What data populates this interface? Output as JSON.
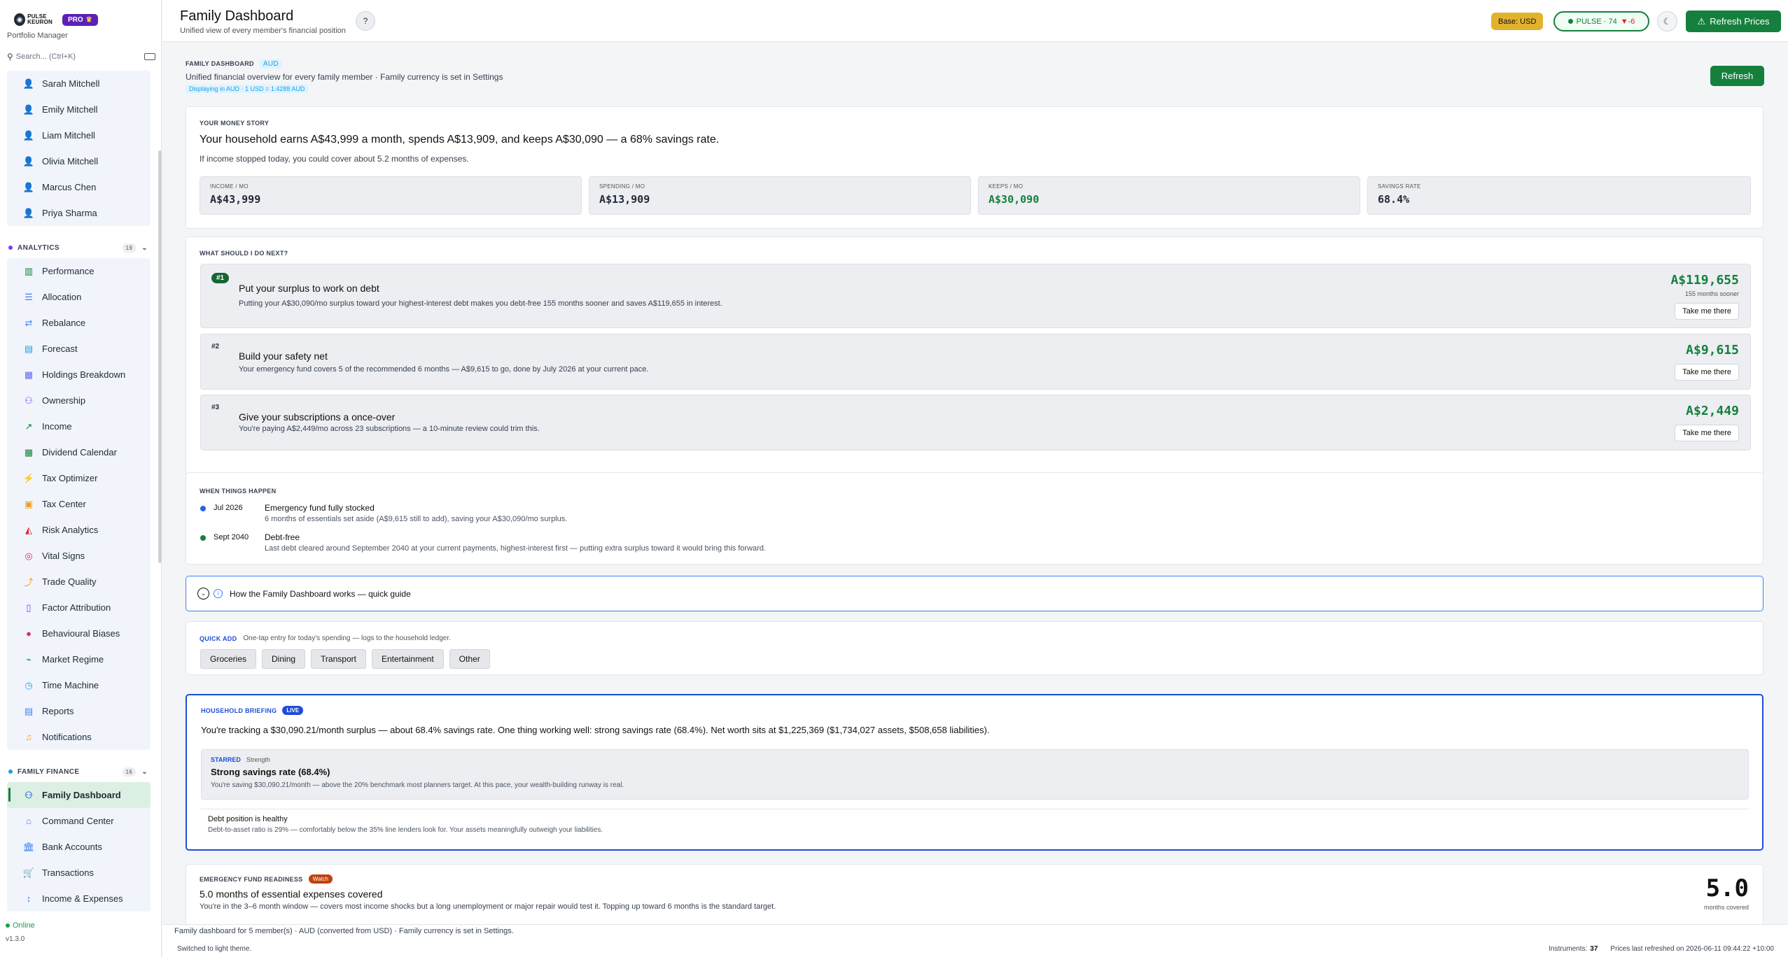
{
  "brand": {
    "logo_line1": "PULSE",
    "logo_line2": "KEURON",
    "pro": "PRO",
    "app_subtitle": "Portfolio Manager"
  },
  "search": {
    "placeholder": "Search... (Ctrl+K)"
  },
  "members": [
    "Sarah Mitchell",
    "Emily Mitchell",
    "Liam Mitchell",
    "Olivia Mitchell",
    "Marcus Chen",
    "Priya Sharma"
  ],
  "analytics": {
    "title": "ANALYTICS",
    "count": "19",
    "items": [
      "Performance",
      "Allocation",
      "Rebalance",
      "Forecast",
      "Holdings Breakdown",
      "Ownership",
      "Income",
      "Dividend Calendar",
      "Tax Optimizer",
      "Tax Center",
      "Risk Analytics",
      "Vital Signs",
      "Trade Quality",
      "Factor Attribution",
      "Behavioural Biases",
      "Market Regime",
      "Time Machine",
      "Reports",
      "Notifications"
    ]
  },
  "family": {
    "title": "FAMILY FINANCE",
    "count": "16",
    "items": [
      "Family Dashboard",
      "Command Center",
      "Bank Accounts",
      "Transactions",
      "Income & Expenses"
    ]
  },
  "status": {
    "online": "Online",
    "version": "v1.3.0"
  },
  "header": {
    "title": "Family Dashboard",
    "subtitle": "Unified view of every member's financial position",
    "help": "?",
    "base": "Base: USD",
    "pulse_label": "PULSE · 74",
    "pulse_change": "▼-6",
    "refresh_prices": "Refresh Prices"
  },
  "intro": {
    "label": "FAMILY DASHBOARD",
    "currency": "AUD",
    "desc": "Unified financial overview for every family member · Family currency is set in Settings",
    "rate_note": "Displaying in AUD · 1 USD = 1.4288 AUD",
    "refresh": "Refresh"
  },
  "story": {
    "label": "YOUR MONEY STORY",
    "headline": "Your household earns A$43,999 a month, spends A$13,909, and keeps A$30,090 — a 68% savings rate.",
    "sub": "If income stopped today, you could cover about 5.2 months of expenses.",
    "stats": [
      {
        "label": "INCOME / MO",
        "value": "A$43,999"
      },
      {
        "label": "SPENDING / MO",
        "value": "A$13,909"
      },
      {
        "label": "KEEPS / MO",
        "value": "A$30,090"
      },
      {
        "label": "SAVINGS RATE",
        "value": "68.4%"
      }
    ]
  },
  "next": {
    "label": "WHAT SHOULD I DO NEXT?",
    "items": [
      {
        "num": "#1",
        "title": "Put your surplus to work on debt",
        "desc": "Putting your A$30,090/mo surplus toward your highest-interest debt makes you debt-free 155 months sooner and saves A$119,655 in interest.",
        "amount": "A$119,655",
        "amount_sub": "155 months sooner",
        "button": "Take me there"
      },
      {
        "num": "#2",
        "title": "Build your safety net",
        "desc": "Your emergency fund covers 5 of the recommended 6 months — A$9,615 to go, done by July 2026 at your current pace.",
        "amount": "A$9,615",
        "button": "Take me there"
      },
      {
        "num": "#3",
        "title": "Give your subscriptions a once-over",
        "desc": "You're paying A$2,449/mo across 23 subscriptions — a 10-minute review could trim this.",
        "amount": "A$2,449",
        "button": "Take me there"
      }
    ]
  },
  "timeline": {
    "label": "WHEN THINGS HAPPEN",
    "items": [
      {
        "date": "Jul 2026",
        "title": "Emergency fund fully stocked",
        "desc": "6 months of essentials set aside (A$9,615 still to add), saving your A$30,090/mo surplus.",
        "color": "#2563eb"
      },
      {
        "date": "Sept 2040",
        "title": "Debt-free",
        "desc": "Last debt cleared around September 2040 at your current payments, highest-interest first — putting extra surplus toward it would bring this forward.",
        "color": "#15803d"
      }
    ]
  },
  "guide": {
    "text": "How the Family Dashboard works — quick guide"
  },
  "quick": {
    "label": "QUICK ADD",
    "desc": "One-tap entry for today's spending — logs to the household ledger.",
    "buttons": [
      "Groceries",
      "Dining",
      "Transport",
      "Entertainment",
      "Other"
    ]
  },
  "briefing": {
    "label": "HOUSEHOLD BRIEFING",
    "badge": "LIVE",
    "text": "You're tracking a $30,090.21/month surplus — about 68.4% savings rate. One thing working well: strong savings rate (68.4%). Net worth sits at $1,225,369 ($1,734,027 assets, $508,658 liabilities).",
    "starred": "STARRED",
    "tag": "Strength",
    "s_title": "Strong savings rate (68.4%)",
    "s_desc": "You're saving $30,090.21/month — above the 20% benchmark most planners target. At this pace, your wealth-building runway is real.",
    "d_title": "Debt position is healthy",
    "d_desc": "Debt-to-asset ratio is 29% — comfortably below the 35% line lenders look for. Your assets meaningfully outweigh your liabilities."
  },
  "emergency": {
    "label": "EMERGENCY FUND READINESS",
    "badge": "Watch",
    "title": "5.0 months of essential expenses covered",
    "desc": "You're in the 3–6 month window — covers most income shocks but a long unemployment or major repair would test it. Topping up toward 6 months is the standard target.",
    "value": "5.0",
    "value_sub": "months covered"
  },
  "footer": {
    "line1": "Family dashboard for 5 member(s) · AUD (converted from USD) · Family currency is set in Settings.",
    "line2": "Switched to light theme.",
    "instruments_label": "Instruments:",
    "instruments": "37",
    "refreshed": "Prices last refreshed on 2026-06-11 09:44:22 +10:00"
  },
  "colors": {
    "accent": "#15803d",
    "brand": "#5b21b6",
    "base_badge": "#e3b22d"
  }
}
